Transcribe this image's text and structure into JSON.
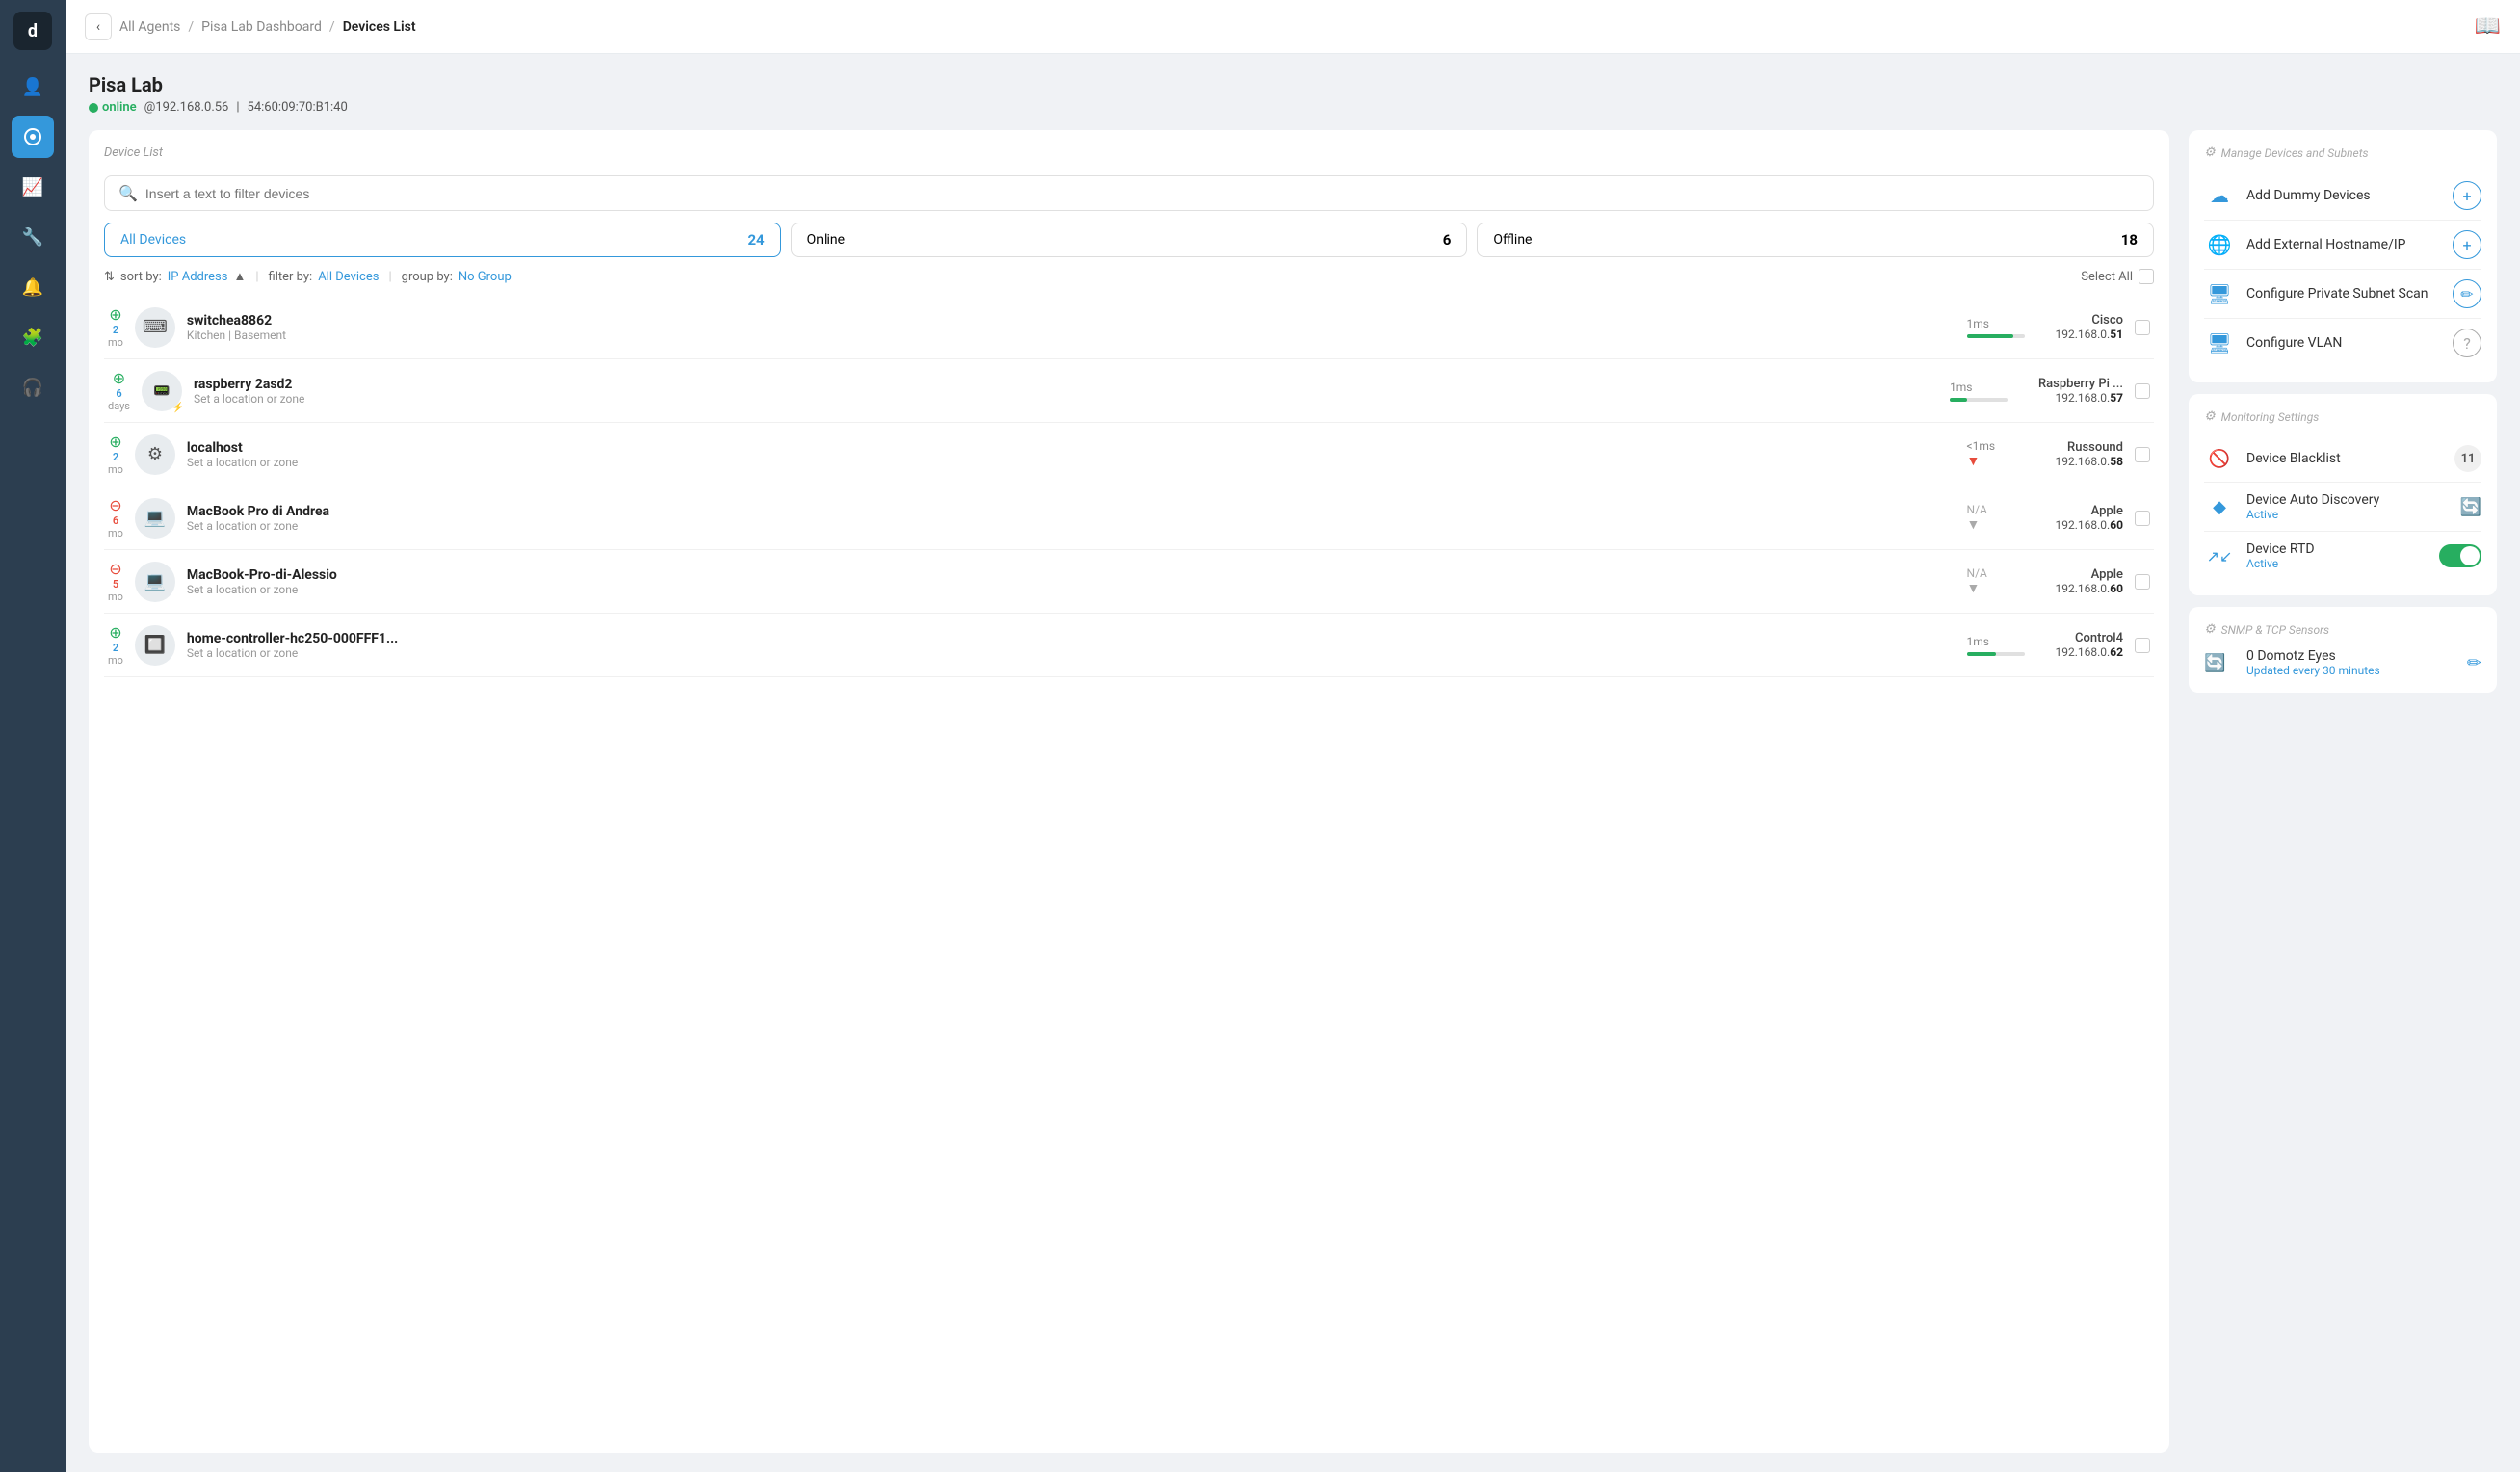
{
  "sidebar": {
    "logo": "d",
    "items": [
      {
        "id": "agents",
        "icon": "👤",
        "active": false
      },
      {
        "id": "dashboard",
        "icon": "📊",
        "active": true
      },
      {
        "id": "analytics",
        "icon": "📈",
        "active": false
      },
      {
        "id": "tools",
        "icon": "🔧",
        "active": false
      },
      {
        "id": "alerts",
        "icon": "🔔",
        "active": false
      },
      {
        "id": "plugins",
        "icon": "🧩",
        "active": false
      },
      {
        "id": "support",
        "icon": "🎧",
        "active": false
      }
    ]
  },
  "breadcrumb": {
    "back": "‹",
    "parts": [
      "All Agents",
      "Pisa Lab Dashboard"
    ],
    "current": "Devices List"
  },
  "topnav_icon": "📖",
  "page": {
    "title": "Pisa Lab",
    "status": "online",
    "ip": "@192.168.0.56",
    "mac": "54:60:09:70:B1:40"
  },
  "device_list": {
    "label": "Device List",
    "search_placeholder": "Insert a text to filter devices",
    "filter_tabs": [
      {
        "id": "all",
        "label": "All Devices",
        "count": "24",
        "active": true
      },
      {
        "id": "online",
        "label": "Online",
        "count": "6",
        "active": false
      },
      {
        "id": "offline",
        "label": "Offline",
        "count": "18",
        "active": false
      }
    ],
    "sort": {
      "label": "sort by:",
      "sort_by": "IP Address",
      "filter_label": "filter by:",
      "filter_by": "All Devices",
      "group_label": "group by:",
      "group_by": "No Group",
      "select_all": "Select All"
    },
    "devices": [
      {
        "id": "d1",
        "name": "switchea8862",
        "location": "Kitchen | Basement",
        "age": "2 mo",
        "status": "up",
        "ping": "1ms",
        "ping_pct": 80,
        "vendor": "Cisco",
        "ip_prefix": "192.168.0.",
        "ip_suffix": "51"
      },
      {
        "id": "d2",
        "name": "raspberry 2asd2",
        "location": "Set a location or zone",
        "age": "6 days",
        "status": "up",
        "ping": "1ms",
        "ping_pct": 30,
        "vendor": "Raspberry Pi ...",
        "ip_prefix": "192.168.0.",
        "ip_suffix": "57"
      },
      {
        "id": "d3",
        "name": "localhost",
        "location": "Set a location or zone",
        "age": "2 mo",
        "status": "up",
        "ping": "<1ms",
        "ping_pct": 15,
        "ping_dir": "down",
        "vendor": "Russound",
        "ip_prefix": "192.168.0.",
        "ip_suffix": "58"
      },
      {
        "id": "d4",
        "name": "MacBook Pro di Andrea",
        "location": "Set a location or zone",
        "age": "6 mo",
        "status": "down",
        "ping": "N/A",
        "ping_pct": 0,
        "vendor": "Apple",
        "ip_prefix": "192.168.0.",
        "ip_suffix": "60"
      },
      {
        "id": "d5",
        "name": "MacBook-Pro-di-Alessio",
        "location": "Set a location or zone",
        "age": "5 mo",
        "status": "down",
        "ping": "N/A",
        "ping_pct": 0,
        "vendor": "Apple",
        "ip_prefix": "192.168.0.",
        "ip_suffix": "60"
      },
      {
        "id": "d6",
        "name": "home-controller-hc250-000FFF1...",
        "location": "Set a location or zone",
        "age": "2 mo",
        "status": "up",
        "ping": "1ms",
        "ping_pct": 50,
        "vendor": "Control4",
        "ip_prefix": "192.168.0.",
        "ip_suffix": "62"
      }
    ]
  },
  "right_panel": {
    "manage_label": "Manage Devices and Subnets",
    "manage_actions": [
      {
        "id": "add-dummy",
        "label": "Add Dummy Devices",
        "icon": "☁",
        "btn": "+"
      },
      {
        "id": "add-hostname",
        "label": "Add External Hostname/IP",
        "icon": "🌐",
        "btn": "+"
      },
      {
        "id": "configure-subnet",
        "label": "Configure Private Subnet Scan",
        "icon": "🖥",
        "btn": "✏"
      },
      {
        "id": "configure-vlan",
        "label": "Configure VLAN",
        "icon": "🖥",
        "btn": "?"
      }
    ],
    "monitoring_label": "Monitoring Settings",
    "monitoring_items": [
      {
        "id": "blacklist",
        "label": "Device Blacklist",
        "icon": "🚫",
        "badge": "11",
        "type": "badge"
      },
      {
        "id": "auto-discovery",
        "label": "Device Auto Discovery",
        "sub": "Active",
        "icon": "◆",
        "type": "refresh"
      },
      {
        "id": "rtd",
        "label": "Device RTD",
        "sub": "Active",
        "icon": "↗",
        "type": "toggle"
      }
    ],
    "snmp_label": "SNMP & TCP Sensors",
    "snmp_items": [
      {
        "id": "domotz",
        "label": "0 Domotz Eyes",
        "sub": "Updated every 30 minutes",
        "icon": "🔄",
        "type": "edit"
      }
    ]
  }
}
